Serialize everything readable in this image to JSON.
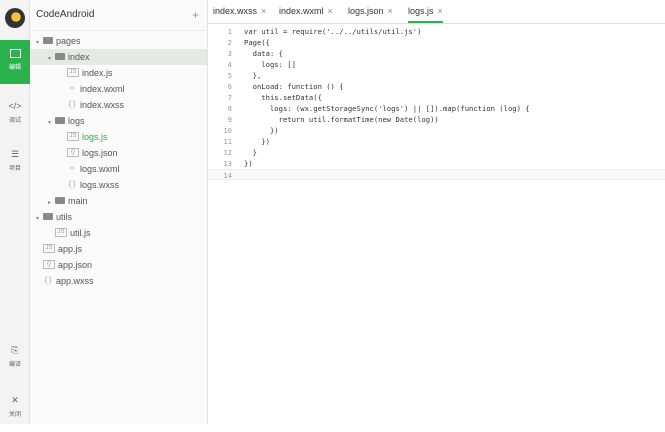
{
  "app": {
    "project_name": "CodeAndroid",
    "add_label": "+"
  },
  "rail": {
    "items": [
      {
        "label": "编辑",
        "icon": "edit-icon"
      },
      {
        "label": "调试",
        "icon": "code-icon"
      },
      {
        "label": "项目",
        "icon": "menu-icon"
      },
      {
        "label": "编译",
        "icon": "compile-icon"
      },
      {
        "label": "关闭",
        "icon": "close-icon"
      }
    ]
  },
  "tree": {
    "nodes": [
      {
        "name": "pages",
        "type": "folder",
        "depth": 0,
        "expanded": true
      },
      {
        "name": "index",
        "type": "folder",
        "depth": 1,
        "expanded": true,
        "selected": true
      },
      {
        "name": "index.js",
        "type": "js",
        "depth": 2
      },
      {
        "name": "index.wxml",
        "type": "wxml",
        "depth": 2
      },
      {
        "name": "index.wxss",
        "type": "wxss",
        "depth": 2
      },
      {
        "name": "logs",
        "type": "folder",
        "depth": 1,
        "expanded": true
      },
      {
        "name": "logs.js",
        "type": "js",
        "depth": 2,
        "current": true
      },
      {
        "name": "logs.json",
        "type": "json",
        "depth": 2
      },
      {
        "name": "logs.wxml",
        "type": "wxml",
        "depth": 2
      },
      {
        "name": "logs.wxss",
        "type": "wxss",
        "depth": 2
      },
      {
        "name": "main",
        "type": "folder",
        "depth": 1,
        "expanded": false
      },
      {
        "name": "utils",
        "type": "folder",
        "depth": 0,
        "expanded": true
      },
      {
        "name": "util.js",
        "type": "js",
        "depth": 1
      },
      {
        "name": "app.js",
        "type": "js",
        "depth": 0
      },
      {
        "name": "app.json",
        "type": "json",
        "depth": 0
      },
      {
        "name": "app.wxss",
        "type": "wxss",
        "depth": 0
      }
    ]
  },
  "tabs": [
    {
      "label": "index.wxss",
      "active": false
    },
    {
      "label": "index.wxml",
      "active": false
    },
    {
      "label": "logs.json",
      "active": false
    },
    {
      "label": "logs.js",
      "active": true
    }
  ],
  "tab_close_glyph": "×",
  "editor": {
    "lines": [
      {
        "no": "1",
        "text": "var util = require('../../utils/util.js')"
      },
      {
        "no": "2",
        "text": "Page({"
      },
      {
        "no": "3",
        "text": "  data: {"
      },
      {
        "no": "4",
        "text": "    logs: []"
      },
      {
        "no": "5",
        "text": "  },"
      },
      {
        "no": "6",
        "text": "  onLoad: function () {"
      },
      {
        "no": "7",
        "text": "    this.setData({"
      },
      {
        "no": "8",
        "text": "      logs: (wx.getStorageSync('logs') || []).map(function (log) {"
      },
      {
        "no": "9",
        "text": "        return util.formatTime(new Date(log))"
      },
      {
        "no": "10",
        "text": "      })"
      },
      {
        "no": "11",
        "text": "    })"
      },
      {
        "no": "12",
        "text": "  }"
      },
      {
        "no": "13",
        "text": "})"
      },
      {
        "no": "14",
        "text": ""
      }
    ],
    "current_line": "14"
  },
  "colors": {
    "accent": "#2bb24c"
  }
}
